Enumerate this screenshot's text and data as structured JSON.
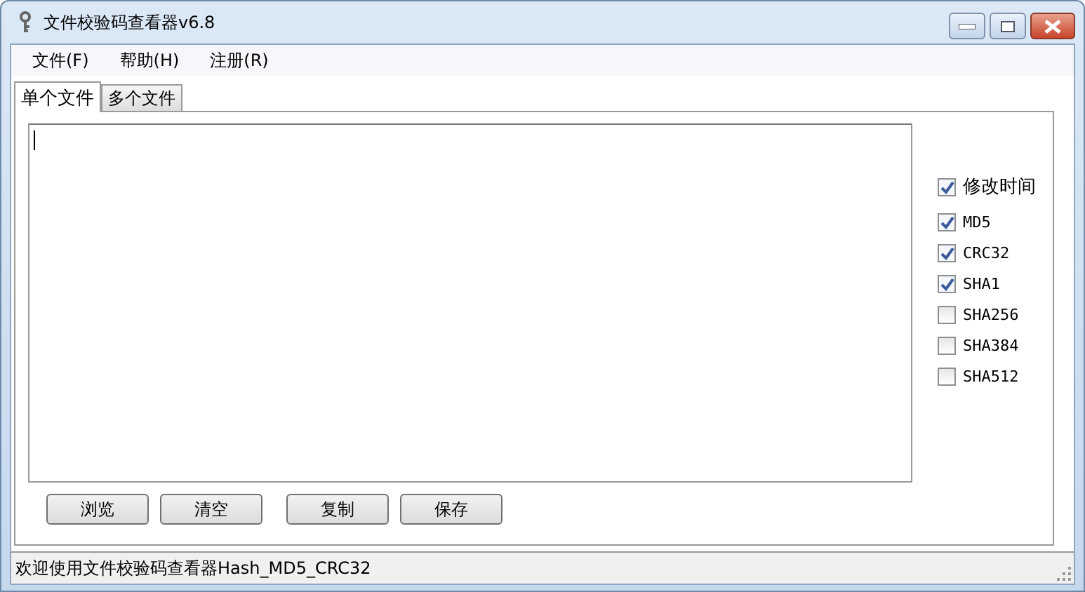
{
  "window": {
    "title": "文件校验码查看器v6.8"
  },
  "menu": [
    "文件(F)",
    "帮助(H)",
    "注册(R)"
  ],
  "tabs": [
    {
      "label": "单个文件",
      "selected": true
    },
    {
      "label": "多个文件",
      "selected": false
    }
  ],
  "options": [
    {
      "label": "修改时间",
      "checked": true,
      "kind": "large"
    },
    {
      "label": "MD5",
      "checked": true,
      "kind": "small"
    },
    {
      "label": "CRC32",
      "checked": true,
      "kind": "small"
    },
    {
      "label": "SHA1",
      "checked": true,
      "kind": "small"
    },
    {
      "label": "SHA256",
      "checked": false,
      "kind": "small"
    },
    {
      "label": "SHA384",
      "checked": false,
      "kind": "small"
    },
    {
      "label": "SHA512",
      "checked": false,
      "kind": "small"
    }
  ],
  "buttons": [
    "浏览",
    "清空",
    "复制",
    "保存"
  ],
  "status_bar": "欢迎使用文件校验码查看器Hash_MD5_CRC32"
}
